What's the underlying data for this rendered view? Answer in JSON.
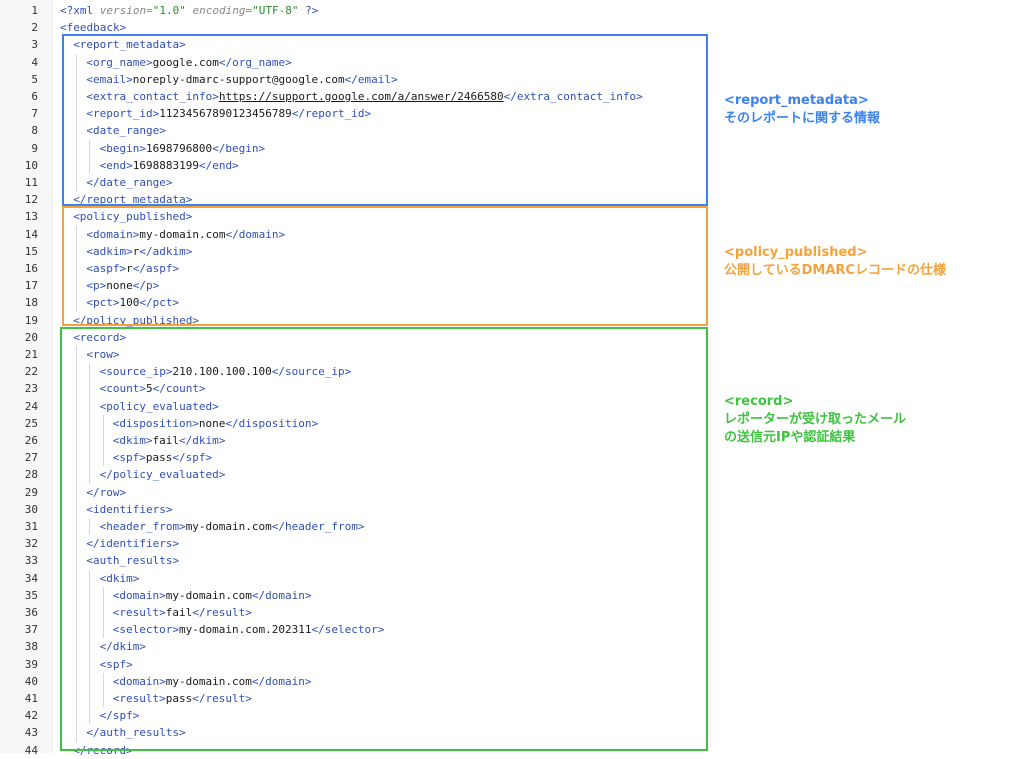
{
  "lines": [
    {
      "n": "1",
      "d": 0,
      "p": [
        [
          "pi",
          "<?xml "
        ],
        [
          "attr",
          "version="
        ],
        [
          "str",
          "\"1.0\""
        ],
        [
          "attr",
          " encoding="
        ],
        [
          "str",
          "\"UTF-8\""
        ],
        [
          "pi",
          " ?>"
        ]
      ]
    },
    {
      "n": "2",
      "d": 0,
      "p": [
        [
          "t",
          "<feedback>"
        ]
      ]
    },
    {
      "n": "3",
      "d": 1,
      "p": [
        [
          "t",
          "<report_metadata>"
        ]
      ]
    },
    {
      "n": "4",
      "d": 2,
      "p": [
        [
          "t",
          "<org_name>"
        ],
        [
          "txt",
          "google.com"
        ],
        [
          "t",
          "</org_name>"
        ]
      ]
    },
    {
      "n": "5",
      "d": 2,
      "p": [
        [
          "t",
          "<email>"
        ],
        [
          "txt",
          "noreply-dmarc-support@google.com"
        ],
        [
          "t",
          "</email>"
        ]
      ]
    },
    {
      "n": "6",
      "d": 2,
      "p": [
        [
          "t",
          "<extra_contact_info>"
        ],
        [
          "link",
          "https://support.google.com/a/answer/2466580"
        ],
        [
          "t",
          "</extra_contact_info>"
        ]
      ]
    },
    {
      "n": "7",
      "d": 2,
      "p": [
        [
          "t",
          "<report_id>"
        ],
        [
          "txt",
          "11234567890123456789"
        ],
        [
          "t",
          "</report_id>"
        ]
      ]
    },
    {
      "n": "8",
      "d": 2,
      "p": [
        [
          "t",
          "<date_range>"
        ]
      ]
    },
    {
      "n": "9",
      "d": 3,
      "p": [
        [
          "t",
          "<begin>"
        ],
        [
          "txt",
          "1698796800"
        ],
        [
          "t",
          "</begin>"
        ]
      ]
    },
    {
      "n": "10",
      "d": 3,
      "p": [
        [
          "t",
          "<end>"
        ],
        [
          "txt",
          "1698883199"
        ],
        [
          "t",
          "</end>"
        ]
      ]
    },
    {
      "n": "11",
      "d": 2,
      "p": [
        [
          "t",
          "</date_range>"
        ]
      ]
    },
    {
      "n": "12",
      "d": 1,
      "p": [
        [
          "t",
          "</report_metadata>"
        ]
      ]
    },
    {
      "n": "13",
      "d": 1,
      "p": [
        [
          "t",
          "<policy_published>"
        ]
      ]
    },
    {
      "n": "14",
      "d": 2,
      "p": [
        [
          "t",
          "<domain>"
        ],
        [
          "txt",
          "my-domain.com"
        ],
        [
          "t",
          "</domain>"
        ]
      ]
    },
    {
      "n": "15",
      "d": 2,
      "p": [
        [
          "t",
          "<adkim>"
        ],
        [
          "txt",
          "r"
        ],
        [
          "t",
          "</adkim>"
        ]
      ]
    },
    {
      "n": "16",
      "d": 2,
      "p": [
        [
          "t",
          "<aspf>"
        ],
        [
          "txt",
          "r"
        ],
        [
          "t",
          "</aspf>"
        ]
      ]
    },
    {
      "n": "17",
      "d": 2,
      "p": [
        [
          "t",
          "<p>"
        ],
        [
          "txt",
          "none"
        ],
        [
          "t",
          "</p>"
        ]
      ]
    },
    {
      "n": "18",
      "d": 2,
      "p": [
        [
          "t",
          "<pct>"
        ],
        [
          "txt",
          "100"
        ],
        [
          "t",
          "</pct>"
        ]
      ]
    },
    {
      "n": "19",
      "d": 1,
      "p": [
        [
          "t",
          "</policy_published>"
        ]
      ]
    },
    {
      "n": "20",
      "d": 1,
      "p": [
        [
          "t",
          "<record>"
        ]
      ]
    },
    {
      "n": "21",
      "d": 2,
      "p": [
        [
          "t",
          "<row>"
        ]
      ]
    },
    {
      "n": "22",
      "d": 3,
      "p": [
        [
          "t",
          "<source_ip>"
        ],
        [
          "txt",
          "210.100.100.100"
        ],
        [
          "t",
          "</source_ip>"
        ]
      ]
    },
    {
      "n": "23",
      "d": 3,
      "p": [
        [
          "t",
          "<count>"
        ],
        [
          "txt",
          "5"
        ],
        [
          "t",
          "</count>"
        ]
      ]
    },
    {
      "n": "24",
      "d": 3,
      "p": [
        [
          "t",
          "<policy_evaluated>"
        ]
      ]
    },
    {
      "n": "25",
      "d": 4,
      "p": [
        [
          "t",
          "<disposition>"
        ],
        [
          "txt",
          "none"
        ],
        [
          "t",
          "</disposition>"
        ]
      ]
    },
    {
      "n": "26",
      "d": 4,
      "p": [
        [
          "t",
          "<dkim>"
        ],
        [
          "txt",
          "fail"
        ],
        [
          "t",
          "</dkim>"
        ]
      ]
    },
    {
      "n": "27",
      "d": 4,
      "p": [
        [
          "t",
          "<spf>"
        ],
        [
          "txt",
          "pass"
        ],
        [
          "t",
          "</spf>"
        ]
      ]
    },
    {
      "n": "28",
      "d": 3,
      "p": [
        [
          "t",
          "</policy_evaluated>"
        ]
      ]
    },
    {
      "n": "29",
      "d": 2,
      "p": [
        [
          "t",
          "</row>"
        ]
      ]
    },
    {
      "n": "30",
      "d": 2,
      "p": [
        [
          "t",
          "<identifiers>"
        ]
      ]
    },
    {
      "n": "31",
      "d": 3,
      "p": [
        [
          "t",
          "<header_from>"
        ],
        [
          "txt",
          "my-domain.com"
        ],
        [
          "t",
          "</header_from>"
        ]
      ]
    },
    {
      "n": "32",
      "d": 2,
      "p": [
        [
          "t",
          "</identifiers>"
        ]
      ]
    },
    {
      "n": "33",
      "d": 2,
      "p": [
        [
          "t",
          "<auth_results>"
        ]
      ]
    },
    {
      "n": "34",
      "d": 3,
      "p": [
        [
          "t",
          "<dkim>"
        ]
      ]
    },
    {
      "n": "35",
      "d": 4,
      "p": [
        [
          "t",
          "<domain>"
        ],
        [
          "txt",
          "my-domain.com"
        ],
        [
          "t",
          "</domain>"
        ]
      ]
    },
    {
      "n": "36",
      "d": 4,
      "p": [
        [
          "t",
          "<result>"
        ],
        [
          "txt",
          "fail"
        ],
        [
          "t",
          "</result>"
        ]
      ]
    },
    {
      "n": "37",
      "d": 4,
      "p": [
        [
          "t",
          "<selector>"
        ],
        [
          "txt",
          "my-domain.com.202311"
        ],
        [
          "t",
          "</selector>"
        ]
      ]
    },
    {
      "n": "38",
      "d": 3,
      "p": [
        [
          "t",
          "</dkim>"
        ]
      ]
    },
    {
      "n": "39",
      "d": 3,
      "p": [
        [
          "t",
          "<spf>"
        ]
      ]
    },
    {
      "n": "40",
      "d": 4,
      "p": [
        [
          "t",
          "<domain>"
        ],
        [
          "txt",
          "my-domain.com"
        ],
        [
          "t",
          "</domain>"
        ]
      ]
    },
    {
      "n": "41",
      "d": 4,
      "p": [
        [
          "t",
          "<result>"
        ],
        [
          "txt",
          "pass"
        ],
        [
          "t",
          "</result>"
        ]
      ]
    },
    {
      "n": "42",
      "d": 3,
      "p": [
        [
          "t",
          "</spf>"
        ]
      ]
    },
    {
      "n": "43",
      "d": 2,
      "p": [
        [
          "t",
          "</auth_results>"
        ]
      ]
    },
    {
      "n": "44",
      "d": 1,
      "p": [
        [
          "t",
          "</record>"
        ]
      ]
    }
  ],
  "annotations": {
    "report_metadata": {
      "title": "<report_metadata>",
      "body": "そのレポートに関する情報",
      "color": "#3b82f0"
    },
    "policy_published": {
      "title": "<policy_published>",
      "body": "公開しているDMARCレコードの仕様",
      "color": "#f5a23a"
    },
    "record": {
      "title": "<record>",
      "body": "レポーターが受け取ったメール\nの送信元IPや認証結果",
      "color": "#3fc23f"
    }
  }
}
